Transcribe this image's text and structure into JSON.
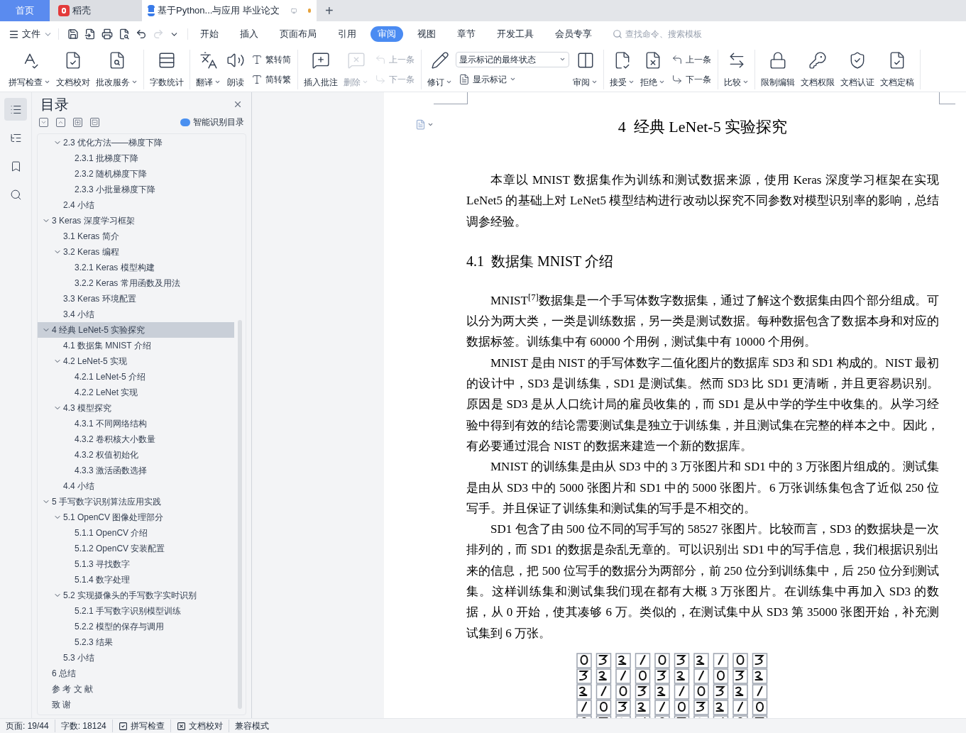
{
  "tabs": [
    {
      "label": "首页",
      "kind": "home",
      "selected": false,
      "unsaved": false
    },
    {
      "label": "稻壳",
      "kind": "app",
      "selected": false,
      "unsaved": false
    },
    {
      "label": "基于Python...与应用 毕业论文",
      "kind": "doc",
      "selected": true,
      "unsaved": true
    }
  ],
  "new_tab": "+",
  "file_menu": "文件",
  "menu_tabs": [
    {
      "label": "开始",
      "selected": false
    },
    {
      "label": "插入",
      "selected": false
    },
    {
      "label": "页面布局",
      "selected": false
    },
    {
      "label": "引用",
      "selected": false
    },
    {
      "label": "审阅",
      "selected": true
    },
    {
      "label": "视图",
      "selected": false
    },
    {
      "label": "章节",
      "selected": false
    },
    {
      "label": "开发工具",
      "selected": false
    },
    {
      "label": "会员专享",
      "selected": false
    }
  ],
  "search": {
    "placeholder": "查找命令、搜索模板"
  },
  "ribbon": [
    {
      "items": [
        {
          "kind": "large",
          "label": "拼写检查",
          "dropdown": true,
          "disabled": false
        },
        {
          "kind": "large",
          "label": "文档校对",
          "dropdown": false,
          "disabled": false
        },
        {
          "kind": "large",
          "label": "批改服务",
          "dropdown": true,
          "disabled": false
        }
      ]
    },
    {
      "items": [
        {
          "kind": "large",
          "label": "字数统计",
          "dropdown": false,
          "disabled": false
        }
      ]
    },
    {
      "items": [
        {
          "kind": "large",
          "label": "翻译",
          "dropdown": true,
          "disabled": false
        },
        {
          "kind": "large",
          "label": "朗读",
          "dropdown": false,
          "disabled": false
        },
        {
          "kind": "small",
          "label": "繁转简",
          "dropdown": false,
          "disabled": false
        },
        {
          "kind": "small",
          "label": "简转繁",
          "dropdown": false,
          "disabled": false
        }
      ]
    },
    {
      "items": [
        {
          "kind": "large",
          "label": "插入批注",
          "dropdown": false,
          "disabled": false
        },
        {
          "kind": "large",
          "label": "删除",
          "dropdown": true,
          "disabled": true
        },
        {
          "kind": "small",
          "label": "上一条",
          "dropdown": false,
          "disabled": true
        },
        {
          "kind": "small",
          "label": "下一条",
          "dropdown": false,
          "disabled": true
        }
      ]
    },
    {
      "items": [
        {
          "kind": "large",
          "label": "修订",
          "dropdown": true,
          "disabled": false
        },
        {
          "kind": "select",
          "label": "显示标记的最终状态",
          "dropdown": true,
          "disabled": false
        },
        {
          "kind": "small",
          "label": "显示标记",
          "dropdown": true,
          "disabled": false
        },
        {
          "kind": "large",
          "label": "审阅",
          "dropdown": true,
          "disabled": false
        }
      ]
    },
    {
      "items": [
        {
          "kind": "large",
          "label": "接受",
          "dropdown": true,
          "disabled": false
        },
        {
          "kind": "large",
          "label": "拒绝",
          "dropdown": true,
          "disabled": false
        },
        {
          "kind": "small",
          "label": "上一条",
          "dropdown": false,
          "disabled": false
        },
        {
          "kind": "small",
          "label": "下一条",
          "dropdown": false,
          "disabled": false
        }
      ]
    },
    {
      "items": [
        {
          "kind": "large",
          "label": "比较",
          "dropdown": true,
          "disabled": false
        }
      ]
    },
    {
      "items": [
        {
          "kind": "large",
          "label": "限制编辑",
          "dropdown": false,
          "disabled": false
        },
        {
          "kind": "large",
          "label": "文档权限",
          "dropdown": false,
          "disabled": false
        },
        {
          "kind": "large",
          "label": "文档认证",
          "dropdown": false,
          "disabled": false
        },
        {
          "kind": "large",
          "label": "文档定稿",
          "dropdown": false,
          "disabled": false
        }
      ]
    }
  ],
  "side_rail": [
    {
      "selected": true
    },
    {
      "selected": false
    },
    {
      "selected": false
    },
    {
      "selected": false
    }
  ],
  "toc": {
    "title": "目录",
    "smart_button": "智能识别目录",
    "continued_items": [
      {
        "label": "2.3  优化方法——梯度下降",
        "selected": false,
        "expanded": true,
        "children": [
          {
            "label": "2.3.1  批梯度下降",
            "selected": false
          },
          {
            "label": "2.3.2  随机梯度下降",
            "selected": false
          },
          {
            "label": "2.3.3  小批量梯度下降",
            "selected": false
          }
        ]
      },
      {
        "label": "2.4  小结",
        "selected": false
      }
    ],
    "items": [
      {
        "label": "3 Keras 深度学习框架",
        "selected": false,
        "expanded": true,
        "children": [
          {
            "label": "3.1 Keras 简介",
            "selected": false
          },
          {
            "label": "3.2 Keras 编程",
            "selected": false,
            "expanded": true,
            "children": [
              {
                "label": "3.2.1 Keras 模型构建",
                "selected": false
              },
              {
                "label": "3.2.2 Keras 常用函数及用法",
                "selected": false
              }
            ]
          },
          {
            "label": "3.3 Keras 环境配置",
            "selected": false
          },
          {
            "label": "3.4  小结",
            "selected": false
          }
        ]
      },
      {
        "label": "4  经典 LeNet-5 实验探究",
        "selected": true,
        "expanded": true,
        "children": [
          {
            "label": "4.1  数据集 MNIST 介绍",
            "selected": false
          },
          {
            "label": "4.2 LeNet-5 实现",
            "selected": false,
            "expanded": true,
            "children": [
              {
                "label": "4.2.1 LeNet-5 介绍",
                "selected": false
              },
              {
                "label": "4.2.2 LeNet 实现",
                "selected": false
              }
            ]
          },
          {
            "label": "4.3  模型探究",
            "selected": false,
            "expanded": true,
            "children": [
              {
                "label": "4.3.1  不同网络结构",
                "selected": false
              },
              {
                "label": "4.3.2  卷积核大小数量",
                "selected": false
              },
              {
                "label": "4.3.2  权值初始化",
                "selected": false
              },
              {
                "label": "4.3.3  激活函数选择",
                "selected": false
              }
            ]
          },
          {
            "label": "4.4  小结",
            "selected": false
          }
        ]
      },
      {
        "label": "5  手写数字识别算法应用实践",
        "selected": false,
        "expanded": true,
        "children": [
          {
            "label": "5.1 OpenCV 图像处理部分",
            "selected": false,
            "expanded": true,
            "children": [
              {
                "label": "5.1.1 OpenCV 介绍",
                "selected": false
              },
              {
                "label": "5.1.2 OpenCV 安装配置",
                "selected": false
              },
              {
                "label": "5.1.3  寻找数字",
                "selected": false
              },
              {
                "label": "5.1.4  数字处理",
                "selected": false
              }
            ]
          },
          {
            "label": "5.2  实现摄像头的手写数字实时识别",
            "selected": false,
            "expanded": true,
            "children": [
              {
                "label": "5.2.1  手写数字识别模型训练",
                "selected": false
              },
              {
                "label": "5.2.2  模型的保存与调用",
                "selected": false
              },
              {
                "label": "5.2.3  结果",
                "selected": false
              }
            ]
          },
          {
            "label": "5.3 小结",
            "selected": false
          }
        ]
      },
      {
        "label": "6  总结",
        "selected": false
      },
      {
        "label": "参 考 文 献",
        "selected": false
      },
      {
        "label": "致 谢",
        "selected": false
      }
    ]
  },
  "document": {
    "title": "4  经典 LeNet-5 实验探究",
    "blocks": [
      {
        "kind": "paragraph",
        "text": "本章以 MNIST 数据集作为训练和测试数据来源，使用 Keras 深度学习框架在实现 LeNet5 的基础上对 LeNet5 模型结构进行改动以探究不同参数对模型识别率的影响，总结调参经验。"
      },
      {
        "kind": "heading",
        "text": "4.1  数据集 MNIST 介绍"
      },
      {
        "kind": "paragraph",
        "text": "MNIST$^{[7]}$数据集是一个手写体数字数据集，通过了解这个数据集由四个部分组成。可以分为两大类，一类是训练数据，另一类是测试数据。每种数据包含了数据本身和对应的数据标签。训练集中有 60000 个用例，测试集中有 10000 个用例。"
      },
      {
        "kind": "paragraph",
        "text": "MNIST 是由 NIST 的手写体数字二值化图片的数据库 SD3 和 SD1 构成的。NIST 最初的设计中，SD3 是训练集，SD1 是测试集。然而 SD3 比 SD1 更清晰，并且更容易识别。原因是 SD3 是从人口统计局的雇员收集的，而 SD1 是从中学的学生中收集的。从学习经验中得到有效的结论需要测试集是独立于训练集，并且测试集在完整的样本之中。因此，有必要通过混合 NIST 的数据来建造一个新的数据库。"
      },
      {
        "kind": "paragraph",
        "text": "MNIST 的训练集是由从 SD3 中的 3 万张图片和 SD1 中的 3 万张图片组成的。测试集是由从 SD3 中的 5000 张图片和 SD1 中的 5000 张图片。6 万张训练集包含了近似 250 位写手。并且保证了训练集和测试集的写手是不相交的。"
      },
      {
        "kind": "paragraph",
        "text": "SD1 包含了由 500 位不同的写手写的 58527 张图片。比较而言，SD3 的数据块是一次排列的，而 SD1 的数据是杂乱无章的。可以识别出 SD1 中的写手信息，我们根据识别出来的信息，把 500 位写手的数据分为两部分，前 250 位分到训练集中，后 250 位分到测试集。这样训练集和测试集我们现在都有大概 3 万张图片。在训练集中再加入 SD3 的数据，从 0 开始，使其凑够 6 万。类似的，在测试集中从 SD3 第 35000 张图开始，补充测试集到 6 万张。"
      },
      {
        "kind": "picture"
      }
    ]
  },
  "status_bar": {
    "page": "页面: 19/44",
    "words": "字数: 18124",
    "spell_check": "拼写检查",
    "proofread": "文档校对",
    "mode": "兼容模式"
  }
}
